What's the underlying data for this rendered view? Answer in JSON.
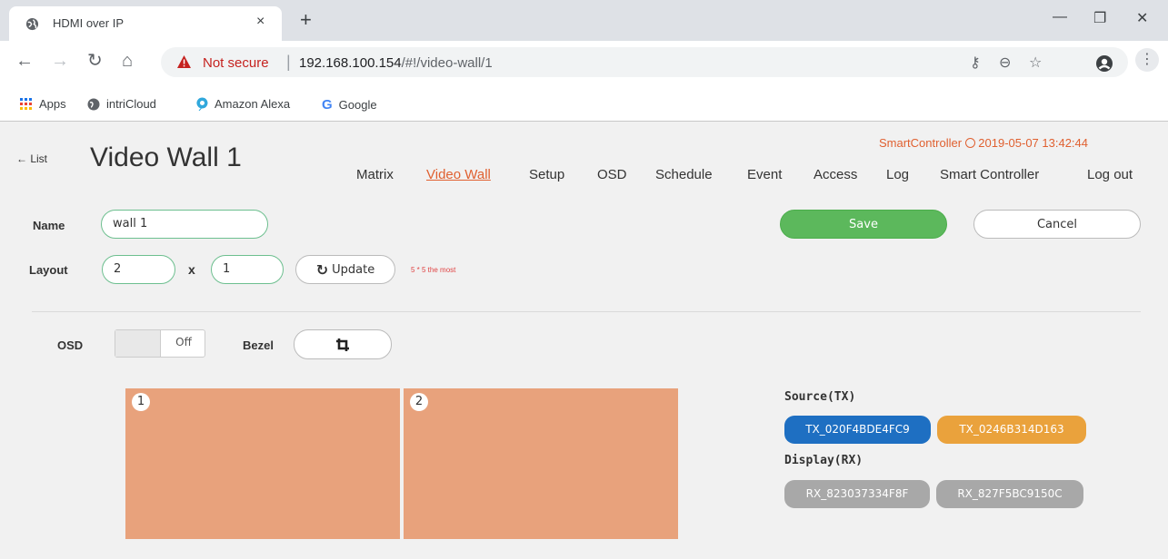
{
  "browser": {
    "tab_title": "HDMI over IP",
    "tab_close": "×",
    "new_tab": "+",
    "not_secure": "Not secure",
    "url_host": "192.168.100.154",
    "url_path": "/#!/video-wall/1",
    "bookmarks": [
      "Apps",
      "intriCloud",
      "Amazon Alexa",
      "Google"
    ]
  },
  "app": {
    "back_label": "← List",
    "title": "Video Wall 1",
    "controller_label": "SmartController",
    "controller_time": "2019-05-07 13:42:44",
    "nav": [
      "Matrix",
      "Video Wall",
      "Setup",
      "OSD",
      "Schedule",
      "Event",
      "Access",
      "Log",
      "Smart Controller",
      "Log out"
    ],
    "nav_active": "Video Wall"
  },
  "form": {
    "name_label": "Name",
    "name_value": "wall 1",
    "layout_label": "Layout",
    "layout_cols": "2",
    "layout_times": "x",
    "layout_rows": "1",
    "update_label": "Update",
    "hint": "5 * 5 the most",
    "save_label": "Save",
    "cancel_label": "Cancel",
    "osd_label": "OSD",
    "osd_state": "Off",
    "bezel_label": "Bezel"
  },
  "wall": {
    "screens": [
      "1",
      "2"
    ],
    "screen_color": "#e8a27c"
  },
  "sources": {
    "title": "Source(TX)",
    "items": [
      {
        "label": "TX_020F4BDE4FC9",
        "color": "#1e6fc2"
      },
      {
        "label": "TX_0246B314D163",
        "color": "#eaa23c"
      }
    ]
  },
  "displays": {
    "title": "Display(RX)",
    "items": [
      {
        "label": "RX_823037334F8F",
        "color": "#a8a8a8"
      },
      {
        "label": "RX_827F5BC9150C",
        "color": "#a8a8a8"
      }
    ]
  }
}
